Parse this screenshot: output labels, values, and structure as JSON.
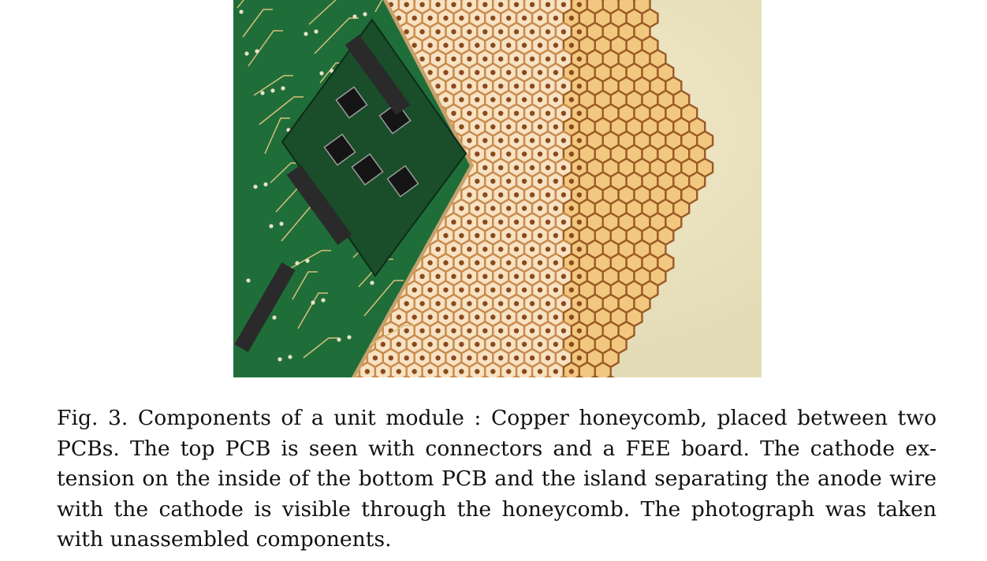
{
  "figure": {
    "alt": "Photograph of a unit module: copper honeycomb between two PCBs with connectors and a FEE board",
    "colors": {
      "background": "#e4dcb7",
      "pcb_green": "#1f6e3a",
      "fee_board": "#1a4d2a",
      "copper_light": "#f7d9a5",
      "copper_dark": "#b06a32",
      "connector": "#2a2a2a"
    }
  },
  "caption": {
    "text": "Fig. 3. Components of a unit module : Copper honeycomb, placed between two PCBs. The top PCB is seen with connectors and a FEE board. The cathode ex­tension on the inside of the bottom PCB and the island separating the anode wire with the cathode is visible through the honeycomb. The photograph was taken with unassembled components."
  }
}
